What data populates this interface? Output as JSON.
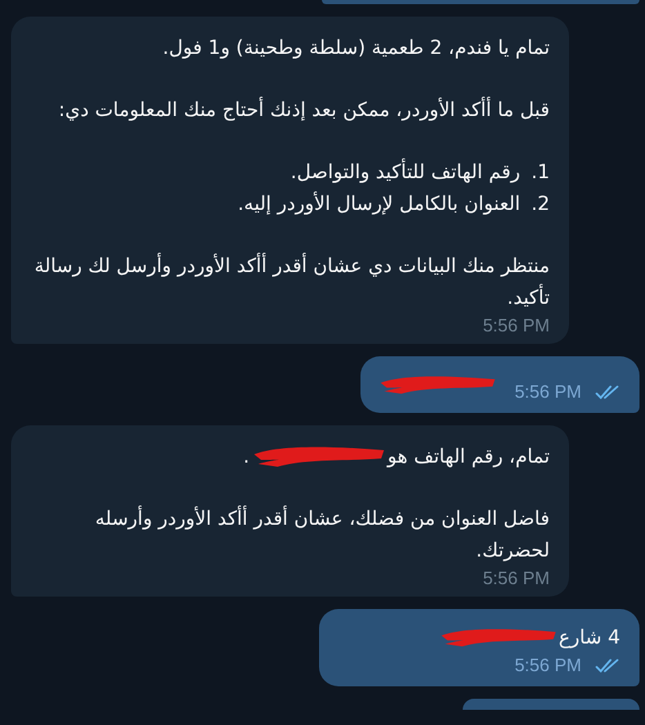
{
  "messages": [
    {
      "kind": "partial-top"
    },
    {
      "kind": "incoming",
      "paragraphs": [
        {
          "kind": "text",
          "text": "تمام يا فندم، 2 طعمية (سلطة وطحينة) و1 فول."
        },
        {
          "kind": "text",
          "text": "قبل ما أأكد الأوردر، ممكن بعد إذنك أحتاج منك المعلومات دي:"
        },
        {
          "kind": "list",
          "items": [
            {
              "number": "1.",
              "text": "رقم الهاتف للتأكيد والتواصل."
            },
            {
              "number": "2.",
              "text": "العنوان بالكامل لإرسال الأوردر إليه."
            }
          ]
        },
        {
          "kind": "text",
          "text": "منتظر منك البيانات دي عشان أقدر أأكد الأوردر وأرسل لك رسالة تأكيد."
        }
      ],
      "time": "5:56 PM"
    },
    {
      "kind": "outgoing",
      "paragraphs": [
        {
          "kind": "text",
          "redacted": true
        }
      ],
      "time": "5:56 PM",
      "read": true
    },
    {
      "kind": "incoming",
      "paragraphs": [
        {
          "kind": "text",
          "text": "تمام، رقم الهاتف هو",
          "redacted": true,
          "after": "."
        },
        {
          "kind": "text",
          "text": "فاضل العنوان من فضلك، عشان أقدر أأكد الأوردر وأرسله لحضرتك."
        }
      ],
      "time": "5:56 PM"
    },
    {
      "kind": "outgoing",
      "paragraphs": [
        {
          "kind": "text",
          "text": "4 شارع",
          "redacted": true
        }
      ],
      "time": "5:56 PM",
      "read": true
    },
    {
      "kind": "partial-bottom"
    }
  ]
}
